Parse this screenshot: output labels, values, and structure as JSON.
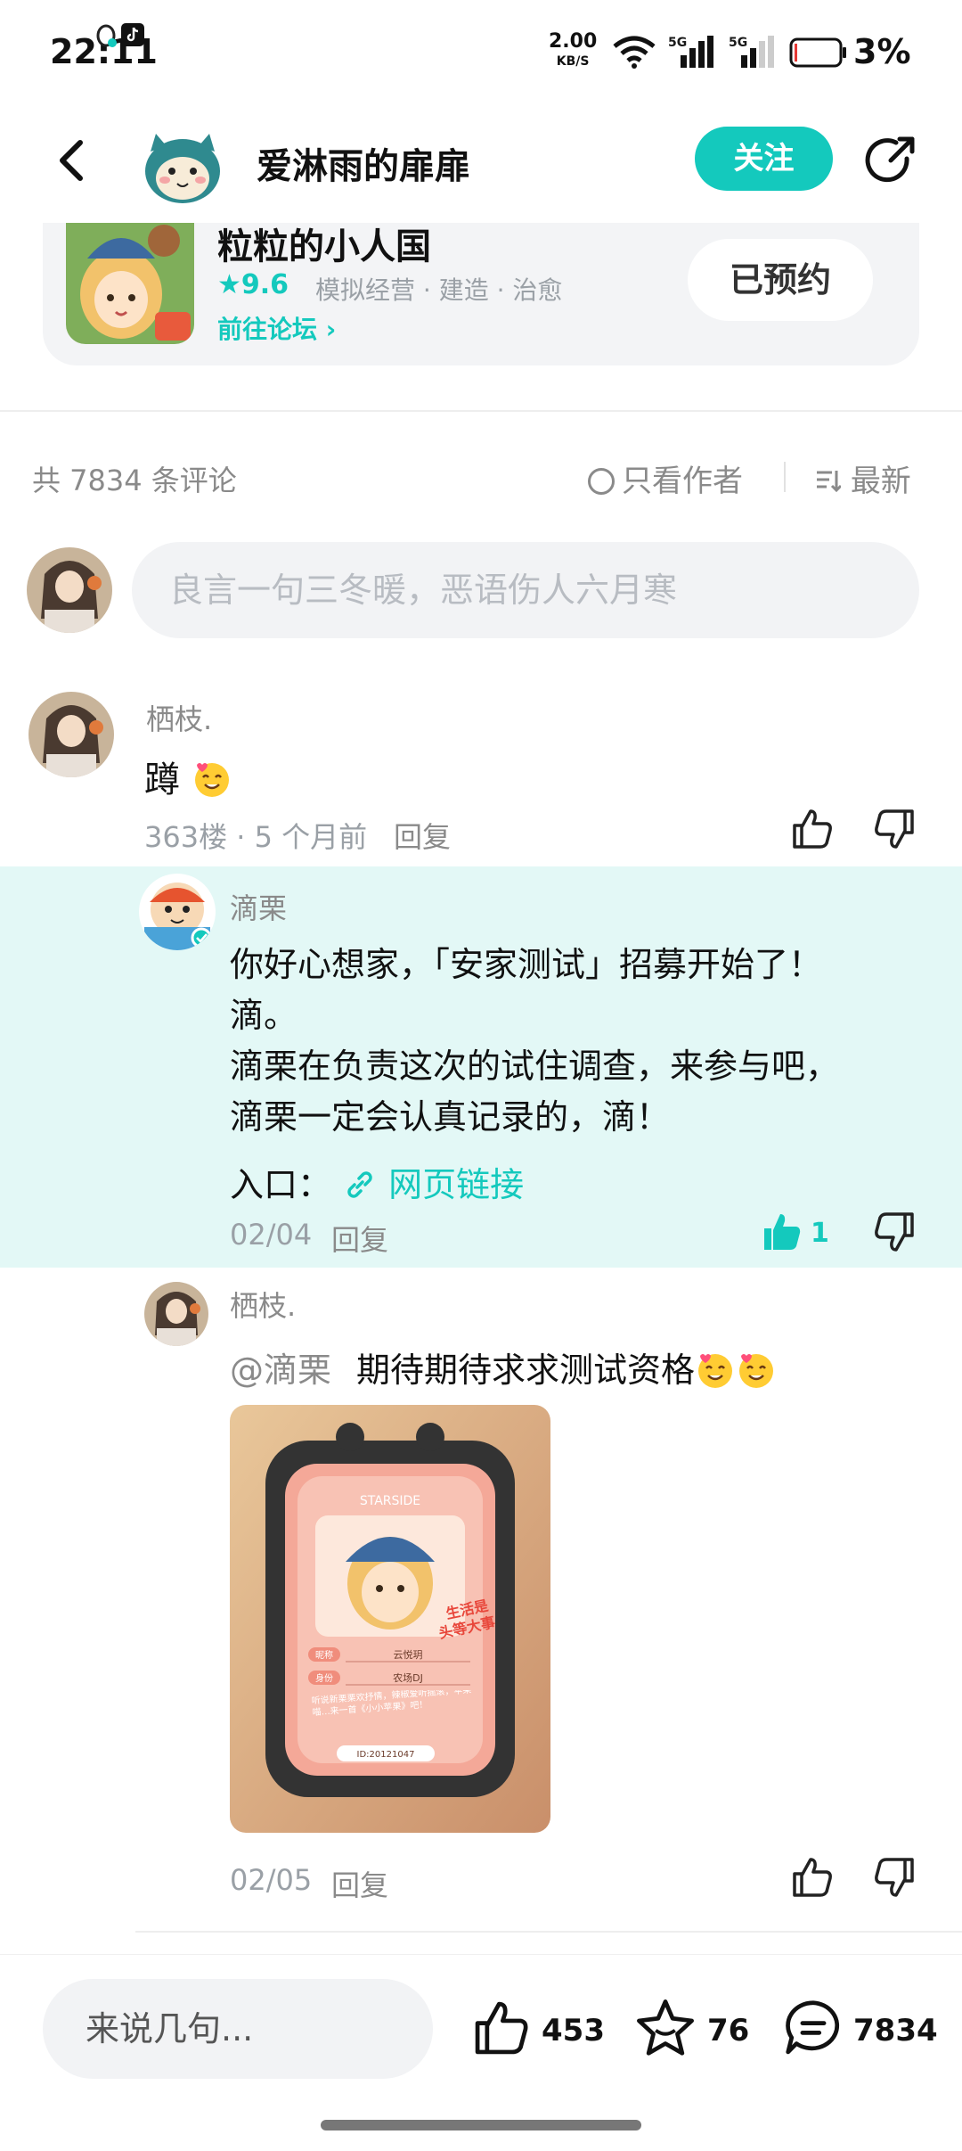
{
  "status_bar": {
    "time": "22:11",
    "net_speed_value": "2.00",
    "net_speed_unit": "KB/S",
    "signal1_label": "5G",
    "signal2_label": "5G",
    "battery": "3%"
  },
  "header": {
    "username": "爱淋雨的扉扉",
    "follow_label": "关注"
  },
  "game": {
    "title": "粒粒的小人国",
    "rating": "9.6",
    "tags": "模拟经营 · 建造 · 治愈",
    "forum_link": "前往论坛",
    "reserved_label": "已预约"
  },
  "comments_bar": {
    "count_text": "共 7834 条评论",
    "author_only_label": "只看作者",
    "sort_label": "最新"
  },
  "comment_input": {
    "placeholder": "良言一句三冬暖，恶语伤人六月寒"
  },
  "comment": {
    "name": "栖枝.",
    "text": "蹲",
    "meta": "363楼 · 5 个月前",
    "reply_label": "回复"
  },
  "reply1": {
    "name": "滴栗",
    "text_lines": [
      "你好心想家，「安家测试」招募开始了！",
      "滴。",
      "滴栗在负责这次的试住调查，来参与吧，",
      "滴栗一定会认真记录的，滴！"
    ],
    "entry_label": "入口：",
    "link_label": "网页链接",
    "date": "02/04",
    "reply_label": "回复",
    "like_count": "1"
  },
  "reply2": {
    "name": "栖枝.",
    "mention": "@滴栗",
    "text": "期待期待求求测试资格",
    "card_brand": "STARSIDE",
    "card_slogan_1": "生活是",
    "card_slogan_2": "头等大事",
    "card_field1_label": "昵称",
    "card_field1_value": "云悦玥",
    "card_field2_label": "身份",
    "card_field2_value": "农场DJ",
    "card_note": "听说新栗栗欢抒情，辣椒爱听摇滚，苹果喵…来一首《小小苹果》吧！",
    "card_id": "ID:20121047",
    "date": "02/05",
    "reply_label": "回复"
  },
  "bottom_bar": {
    "input_placeholder": "来说几句...",
    "likes": "453",
    "favorites": "76",
    "comments": "7834"
  },
  "colors": {
    "accent": "#14c9bd",
    "highlight_bg": "#e3f8f6",
    "muted_text": "#8a8a8a"
  }
}
